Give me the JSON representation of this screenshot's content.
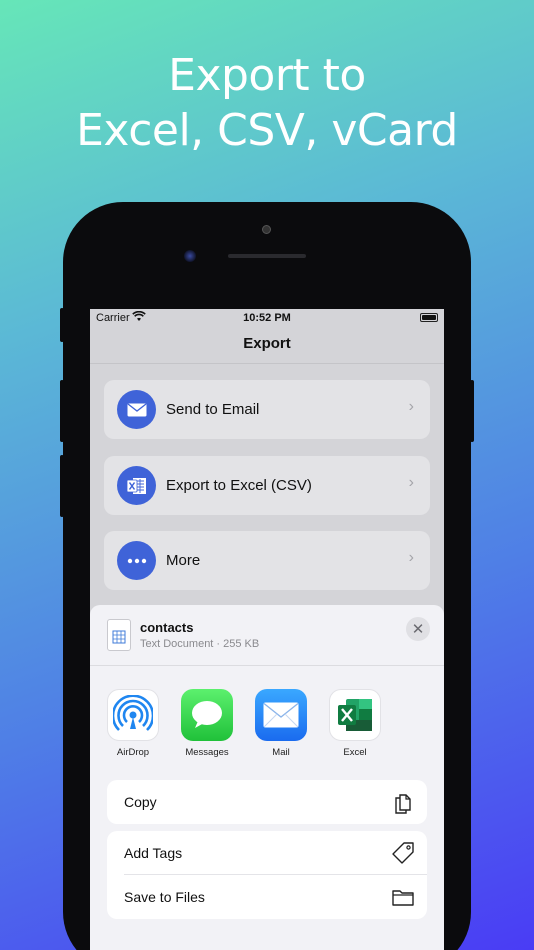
{
  "promo": {
    "line1": "Export to",
    "line2": "Excel, CSV, vCard"
  },
  "status_bar": {
    "carrier": "Carrier",
    "time": "10:52 PM"
  },
  "nav": {
    "title": "Export"
  },
  "menu": [
    {
      "label": "Send to Email",
      "icon": "envelope-icon"
    },
    {
      "label": "Export to Excel (CSV)",
      "icon": "excel-doc-icon"
    },
    {
      "label": "More",
      "icon": "ellipsis-icon"
    }
  ],
  "share_sheet": {
    "file_name": "contacts",
    "file_meta": "Text Document · 255 KB",
    "close_icon": "close-icon",
    "apps": [
      {
        "label": "AirDrop",
        "icon": "airdrop-icon"
      },
      {
        "label": "Messages",
        "icon": "messages-icon"
      },
      {
        "label": "Mail",
        "icon": "mail-icon"
      },
      {
        "label": "Excel",
        "icon": "excel-icon"
      }
    ],
    "actions": [
      {
        "label": "Copy",
        "icon": "copy-icon"
      },
      {
        "label": "Add Tags",
        "icon": "tag-icon"
      },
      {
        "label": "Save to Files",
        "icon": "folder-icon"
      }
    ]
  },
  "colors": {
    "accent": "#3f63d8",
    "messages_green": "#34c759",
    "mail_blue": "#1f7cf2",
    "excel_green": "#1d6f42"
  }
}
